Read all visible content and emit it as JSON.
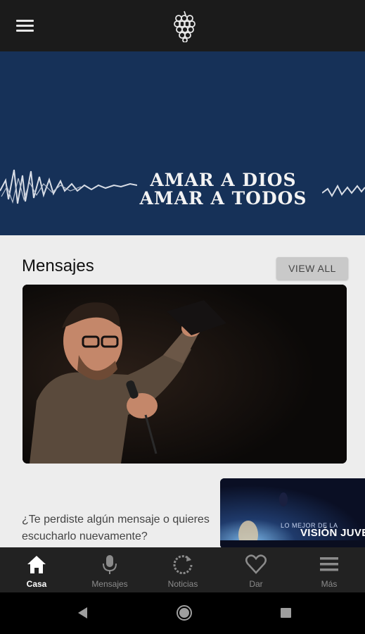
{
  "hero": {
    "line1": "AMAR A DIOS",
    "line2": "AMAR A TODOS"
  },
  "section": {
    "title": "Mensajes",
    "view_all_label": "VIEW ALL",
    "description": "¿Te perdiste algún mensaje o quieres escucharlo nuevamente?"
  },
  "thumbnail": {
    "subtitle": "LO MEJOR DE LA",
    "title": "VISIÓN JUVE"
  },
  "tabs": [
    {
      "label": "Casa",
      "icon": "home-icon",
      "active": true
    },
    {
      "label": "Mensajes",
      "icon": "microphone-icon",
      "active": false
    },
    {
      "label": "Noticias",
      "icon": "refresh-icon",
      "active": false
    },
    {
      "label": "Dar",
      "icon": "heart-icon",
      "active": false
    },
    {
      "label": "Más",
      "icon": "menu-icon",
      "active": false
    }
  ],
  "colors": {
    "hero_background": "#163158",
    "app_bar": "#1b1b1b",
    "tab_bar": "#222222",
    "content_background": "#ededed"
  }
}
